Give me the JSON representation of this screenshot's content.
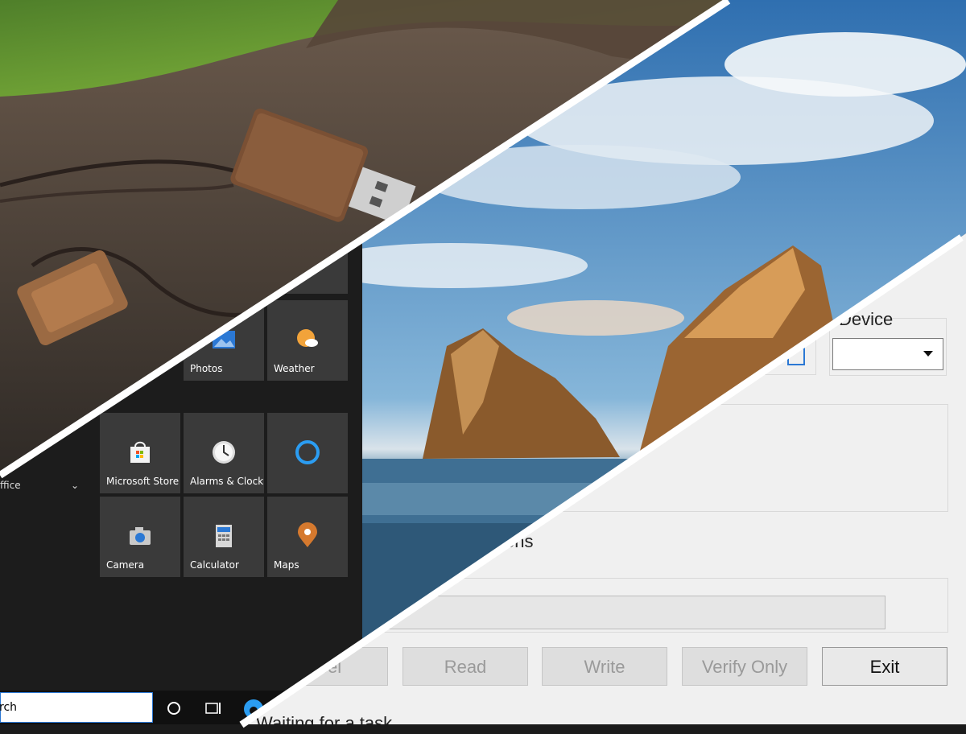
{
  "start_menu": {
    "tiles_row1": [
      {
        "label": "Photos",
        "icon": "photos-icon"
      },
      {
        "label": "Weather",
        "icon": "weather-icon"
      }
    ],
    "tiles_row2": [
      {
        "label": "Microsoft Store",
        "icon": "store-icon"
      },
      {
        "label": "Alarms & Clock",
        "icon": "alarm-clock-icon"
      },
      {
        "label": "",
        "icon": "cortana-icon"
      }
    ],
    "tiles_row3": [
      {
        "label": "Camera",
        "icon": "camera-icon"
      },
      {
        "label": "Calculator",
        "icon": "calculator-icon"
      },
      {
        "label": "Maps",
        "icon": "maps-icon"
      }
    ],
    "app_list_item": "ffice"
  },
  "taskbar": {
    "search_text": "rch"
  },
  "imager": {
    "device_label": "Device",
    "options_label": "tions",
    "buttons": {
      "cancel": "ncel",
      "read": "Read",
      "write": "Write",
      "verify": "Verify Only",
      "exit": "Exit"
    },
    "status_text": "Waiting for a task."
  },
  "colors": {
    "accent": "#2b78d4",
    "tile": "#3a3a3a",
    "window_bg": "#f0f0f0"
  }
}
